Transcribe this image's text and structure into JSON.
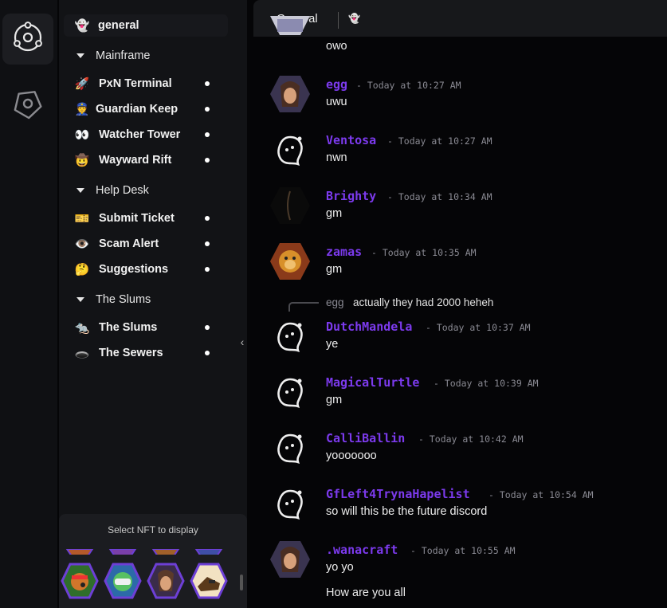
{
  "rail": {
    "items": [
      {
        "icon": "orbit-icon"
      },
      {
        "icon": "tag-icon"
      }
    ]
  },
  "sidebar": {
    "top_channel": {
      "emoji": "👻",
      "label": "general"
    },
    "categories": [
      {
        "label": "Mainframe",
        "channels": [
          {
            "emoji": "🚀",
            "label": "PxN Terminal"
          },
          {
            "emoji": "👮",
            "label": "Guardian Keep"
          },
          {
            "emoji": "👀",
            "label": "Watcher Tower"
          },
          {
            "emoji": "🤠",
            "label": "Wayward Rift"
          }
        ]
      },
      {
        "label": "Help Desk",
        "channels": [
          {
            "emoji": "🎫",
            "label": "Submit Ticket"
          },
          {
            "emoji": "👁️",
            "label": "Scam Alert"
          },
          {
            "emoji": "🤔",
            "label": "Suggestions"
          }
        ]
      },
      {
        "label": "The Slums",
        "channels": [
          {
            "emoji": "🐀",
            "label": "The Slums"
          },
          {
            "emoji": "🕳️",
            "label": "The Sewers"
          }
        ]
      }
    ],
    "collapse_glyph": "‹",
    "nft_panel": {
      "caption": "Select NFT to display"
    }
  },
  "header": {
    "tab_label": "General",
    "ghost_emoji": "👻"
  },
  "messages": [
    {
      "user": "",
      "time": "",
      "text": "owo",
      "avatar": "photo-avatar"
    },
    {
      "user": "egg",
      "time": "- Today at 10:27 AM",
      "text": "uwu",
      "avatar": "anime-avatar"
    },
    {
      "user": "Ventosa",
      "time": "- Today at 10:27 AM",
      "text": "nwn",
      "avatar": "ghost-avatar"
    },
    {
      "user": "Brighty",
      "time": "- Today at 10:34 AM",
      "text": "gm",
      "avatar": "dark-avatar"
    },
    {
      "user": "zamas",
      "time": "- Today at 10:35 AM",
      "text": "gm",
      "avatar": "lion-avatar"
    },
    {
      "reply": {
        "user": "egg",
        "text": "actually they had 2000 heheh"
      }
    },
    {
      "user": "DutchMandela",
      "time": "- Today at 10:37 AM",
      "text": "ye",
      "avatar": "ghost-avatar"
    },
    {
      "user": "MagicalTurtle",
      "time": "- Today at 10:39 AM",
      "text": "gm",
      "avatar": "ghost-avatar"
    },
    {
      "user": "CalliBallin",
      "time": "- Today at 10:42 AM",
      "text": "yooooooo",
      "avatar": "ghost-avatar"
    },
    {
      "user": "GfLeft4TrynaHapelist",
      "time": "- Today at 10:54 AM",
      "text": "so will this be the future discord",
      "avatar": "ghost-avatar"
    },
    {
      "user": ".wanacraft",
      "time": "- Today at 10:55 AM",
      "text": "yo yo",
      "avatar": "anime-avatar"
    },
    {
      "user": "",
      "time": "",
      "text": "How are you all",
      "avatar": ""
    }
  ],
  "colors": {
    "username": "#7c3aed",
    "background": "#050507",
    "sidebar": "#121316",
    "rail": "#0f1013",
    "hex_border": "#6d3fd6"
  }
}
